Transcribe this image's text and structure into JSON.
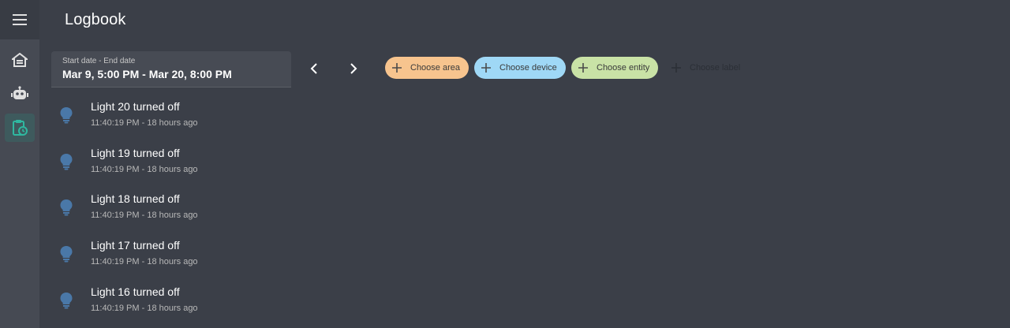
{
  "app": {
    "title": "Logbook"
  },
  "sidebar": {
    "items": [
      {
        "name": "overview",
        "icon": "home-icon"
      },
      {
        "name": "automation",
        "icon": "robot-icon"
      },
      {
        "name": "logbook",
        "icon": "clipboard-clock-icon",
        "active": true
      }
    ]
  },
  "date_picker": {
    "label": "Start date - End date",
    "value": "Mar 9, 5:00 PM - Mar 20, 8:00 PM"
  },
  "filters": {
    "area": "Choose area",
    "device": "Choose device",
    "entity": "Choose entity",
    "label": "Choose label"
  },
  "colors": {
    "area_chip": "#f7c48e",
    "device_chip": "#9fd8f6",
    "entity_chip": "#c9e2a6",
    "bulb_icon": "#4a78a8",
    "active_nav": "#2fb8a0"
  },
  "entries": [
    {
      "message": "Light 20 turned off",
      "time": "11:40:19 PM - 18 hours ago",
      "icon": "lightbulb-icon"
    },
    {
      "message": "Light 19 turned off",
      "time": "11:40:19 PM - 18 hours ago",
      "icon": "lightbulb-icon"
    },
    {
      "message": "Light 18 turned off",
      "time": "11:40:19 PM - 18 hours ago",
      "icon": "lightbulb-icon"
    },
    {
      "message": "Light 17 turned off",
      "time": "11:40:19 PM - 18 hours ago",
      "icon": "lightbulb-icon"
    },
    {
      "message": "Light 16 turned off",
      "time": "11:40:19 PM - 18 hours ago",
      "icon": "lightbulb-icon"
    }
  ]
}
